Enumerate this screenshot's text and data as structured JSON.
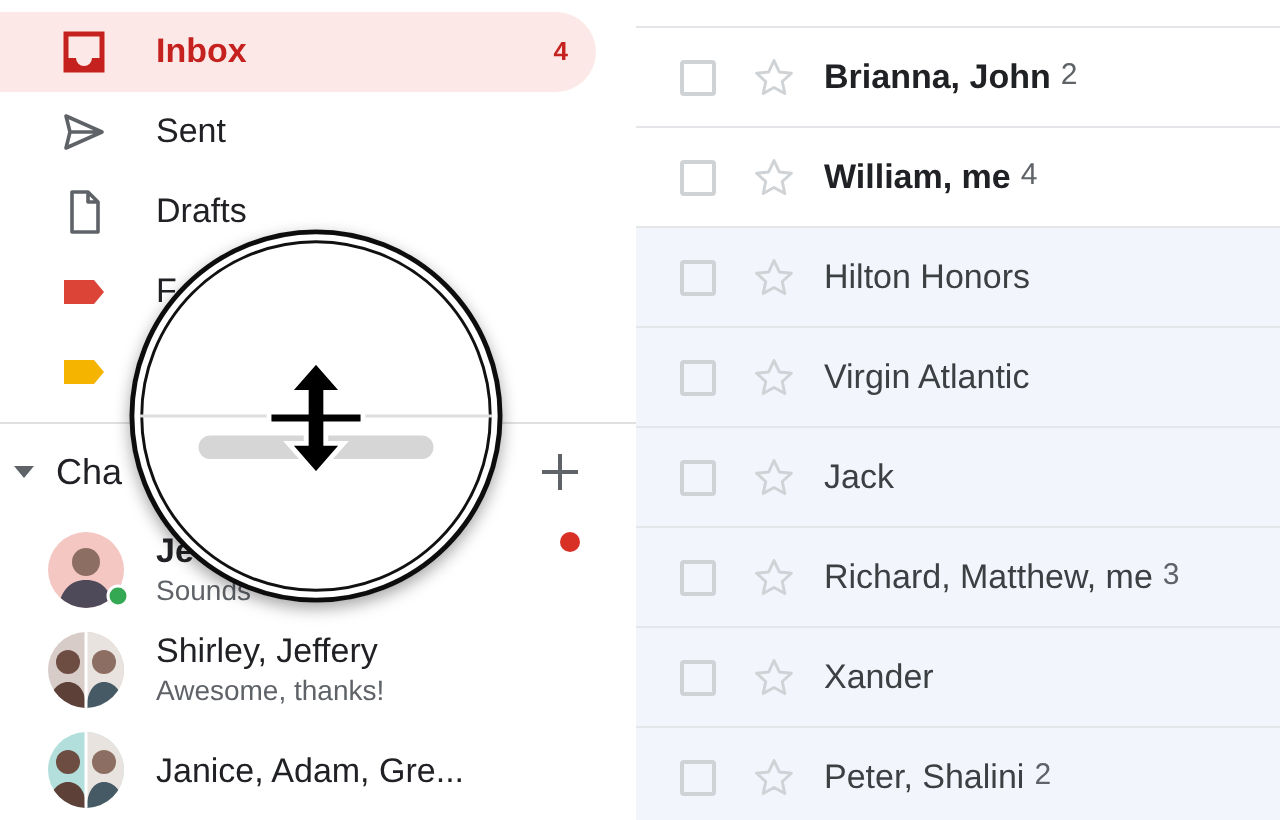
{
  "sidebar": {
    "items": [
      {
        "kind": "inbox",
        "label": "Inbox",
        "count": "4",
        "selected": true
      },
      {
        "kind": "sent",
        "label": "Sent",
        "selected": false
      },
      {
        "kind": "drafts",
        "label": "Drafts",
        "selected": false
      },
      {
        "kind": "label",
        "label": "F",
        "color": "#db4437",
        "selected": false
      },
      {
        "kind": "label",
        "color": "#f4b400",
        "selected": false
      }
    ]
  },
  "chat": {
    "title": "Cha",
    "expanded": true,
    "conversations": [
      {
        "name": "Je",
        "snippet": "Sounds",
        "unread": true,
        "online": true,
        "kind": "single"
      },
      {
        "name": "Shirley, Jeffery",
        "snippet": "Awesome, thanks!",
        "unread": false,
        "online": false,
        "kind": "group"
      },
      {
        "name": "Janice, Adam, Gre...",
        "unread": false,
        "online": false,
        "kind": "group"
      }
    ]
  },
  "mails": [
    {
      "sender": "Brianna, John",
      "count": "2",
      "unread": true,
      "checked": false,
      "starred": false
    },
    {
      "sender": "William, me",
      "count": "4",
      "unread": true,
      "checked": false,
      "starred": false
    },
    {
      "sender": "Hilton Honors",
      "unread": false,
      "checked": false,
      "starred": false
    },
    {
      "sender": "Virgin Atlantic",
      "unread": false,
      "checked": false,
      "starred": false
    },
    {
      "sender": "Jack",
      "unread": false,
      "checked": false,
      "starred": false
    },
    {
      "sender": "Richard, Matthew, me",
      "count": "3",
      "unread": false,
      "checked": false,
      "starred": false
    },
    {
      "sender": "Xander",
      "unread": false,
      "checked": false,
      "starred": false
    },
    {
      "sender": "Peter, Shalini",
      "count": "2",
      "unread": false,
      "checked": false,
      "starred": false
    }
  ]
}
